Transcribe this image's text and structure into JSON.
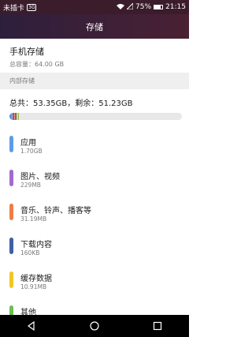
{
  "status_bar": {
    "carrier": "未插卡",
    "badge": "3G",
    "battery_text": "75%",
    "battery_level": 0.75,
    "time": "21:15"
  },
  "title": "存储",
  "phone_storage": {
    "title": "手机存储",
    "capacity": "总容量：64.00 GB"
  },
  "section_header": "内部存储",
  "total_line": "总共：53.35GB，剩余：51.23GB",
  "usage_bar": [
    {
      "color": "#4a90e2",
      "fraction": 0.011
    },
    {
      "color": "#f06292",
      "fraction": 0.004
    },
    {
      "color": "#b0b0b0",
      "fraction": 0.004
    },
    {
      "color": "#7e57c2",
      "fraction": 0.01
    },
    {
      "color": "#ff8a65",
      "fraction": 0.004
    },
    {
      "color": "#5c6bc0",
      "fraction": 0.006
    },
    {
      "color": "#fdd835",
      "fraction": 0.009
    },
    {
      "color": "#8bc34a",
      "fraction": 0.006
    }
  ],
  "categories": [
    {
      "name": "应用",
      "size": "1.70GB",
      "color": "#5b9de6"
    },
    {
      "name": "图片、视频",
      "size": "229MB",
      "color": "#a26ad1"
    },
    {
      "name": "音乐、铃声、播客等",
      "size": "31.19MB",
      "color": "#ef7c4a"
    },
    {
      "name": "下载内容",
      "size": "160KB",
      "color": "#3f5fa6"
    },
    {
      "name": "缓存数据",
      "size": "10.91MB",
      "color": "#f3c623"
    },
    {
      "name": "其他",
      "size": "",
      "color": "#6cbf52"
    }
  ]
}
